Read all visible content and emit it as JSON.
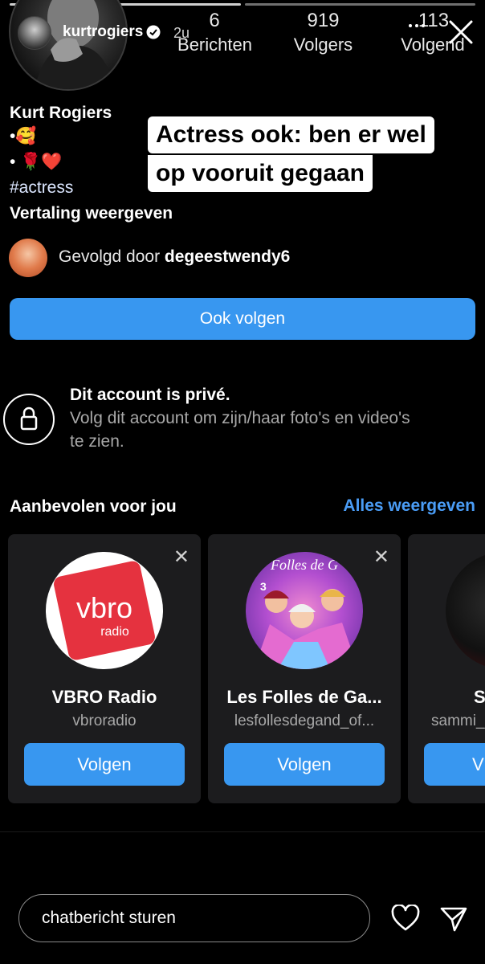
{
  "story": {
    "username": "kurtrogiers",
    "time_ago": "2u"
  },
  "profile": {
    "stats": [
      {
        "value": "6",
        "label": "Berichten"
      },
      {
        "value": "919",
        "label": "Volgers"
      },
      {
        "value": "113",
        "label": "Volgend"
      }
    ],
    "name": "Kurt Rogiers",
    "bio_line1": "•🥰",
    "bio_line2": "• 🌹❤️",
    "hashtag": "#actress",
    "translate": "Vertaling weergeven",
    "followed_by_prefix": "Gevolgd door ",
    "followed_by_user": "degeestwendy6",
    "follow_button": "Ook volgen"
  },
  "overlay": {
    "line1": "Actress ook: ben er wel",
    "line2": "op vooruit gegaan"
  },
  "private": {
    "title": "Dit account is privé.",
    "desc_line1": "Volg dit account om zijn/haar foto's en video's",
    "desc_line2": "te zien."
  },
  "suggested": {
    "header": "Aanbevolen voor jou",
    "see_all": "Alles weergeven",
    "cards": [
      {
        "name": "VBRO Radio",
        "username": "vbroradio",
        "button": "Volgen",
        "logo_text": "vbro",
        "logo_sub": "radio"
      },
      {
        "name": "Les Folles de Ga...",
        "username": "lesfollesdegand_of...",
        "button": "Volgen",
        "image_text": "Folles de G",
        "image_sub": "3"
      },
      {
        "name": "S",
        "username": "sammi_",
        "button": "V"
      }
    ]
  },
  "footer": {
    "chat_placeholder": "chatbericht sturen"
  },
  "colors": {
    "accent": "#3897f0",
    "card_bg": "#1c1c1e",
    "link": "#4a9cf5"
  }
}
